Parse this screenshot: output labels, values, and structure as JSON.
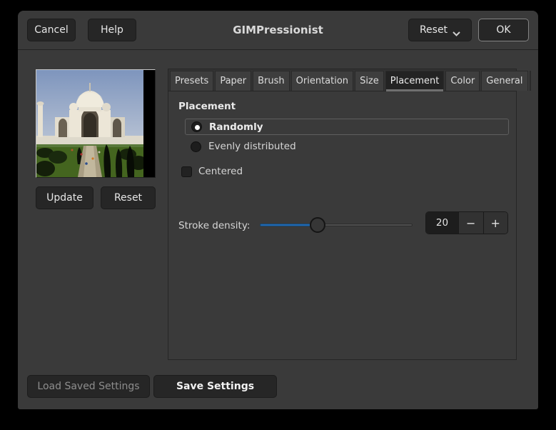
{
  "window": {
    "title": "GIMPressionist"
  },
  "header": {
    "cancel_label": "Cancel",
    "help_label": "Help",
    "reset_label": "Reset",
    "ok_label": "OK"
  },
  "preview": {
    "image_name": "taj-mahal-preview",
    "update_label": "Update",
    "reset_label": "Reset"
  },
  "tabs": {
    "items": [
      {
        "label": "Presets",
        "selected": false
      },
      {
        "label": "Paper",
        "selected": false
      },
      {
        "label": "Brush",
        "selected": false
      },
      {
        "label": "Orientation",
        "selected": false
      },
      {
        "label": "Size",
        "selected": false
      },
      {
        "label": "Placement",
        "selected": true
      },
      {
        "label": "Color",
        "selected": false
      },
      {
        "label": "General",
        "selected": false
      }
    ]
  },
  "placement": {
    "heading": "Placement",
    "radio_options": [
      {
        "label": "Randomly",
        "selected": true
      },
      {
        "label": "Evenly distributed",
        "selected": false
      }
    ],
    "centered": {
      "label": "Centered",
      "checked": false
    },
    "stroke_density": {
      "label": "Stroke density:",
      "value": "20",
      "slider_percent": 38,
      "minus_label": "−",
      "plus_label": "+"
    }
  },
  "footer": {
    "load_label": "Load Saved Settings",
    "load_enabled": false,
    "save_label": "Save Settings"
  },
  "colors": {
    "accent_blue": "#2268b2",
    "window_bg": "#3a3a3a",
    "selected_tab_bg": "#232323"
  }
}
